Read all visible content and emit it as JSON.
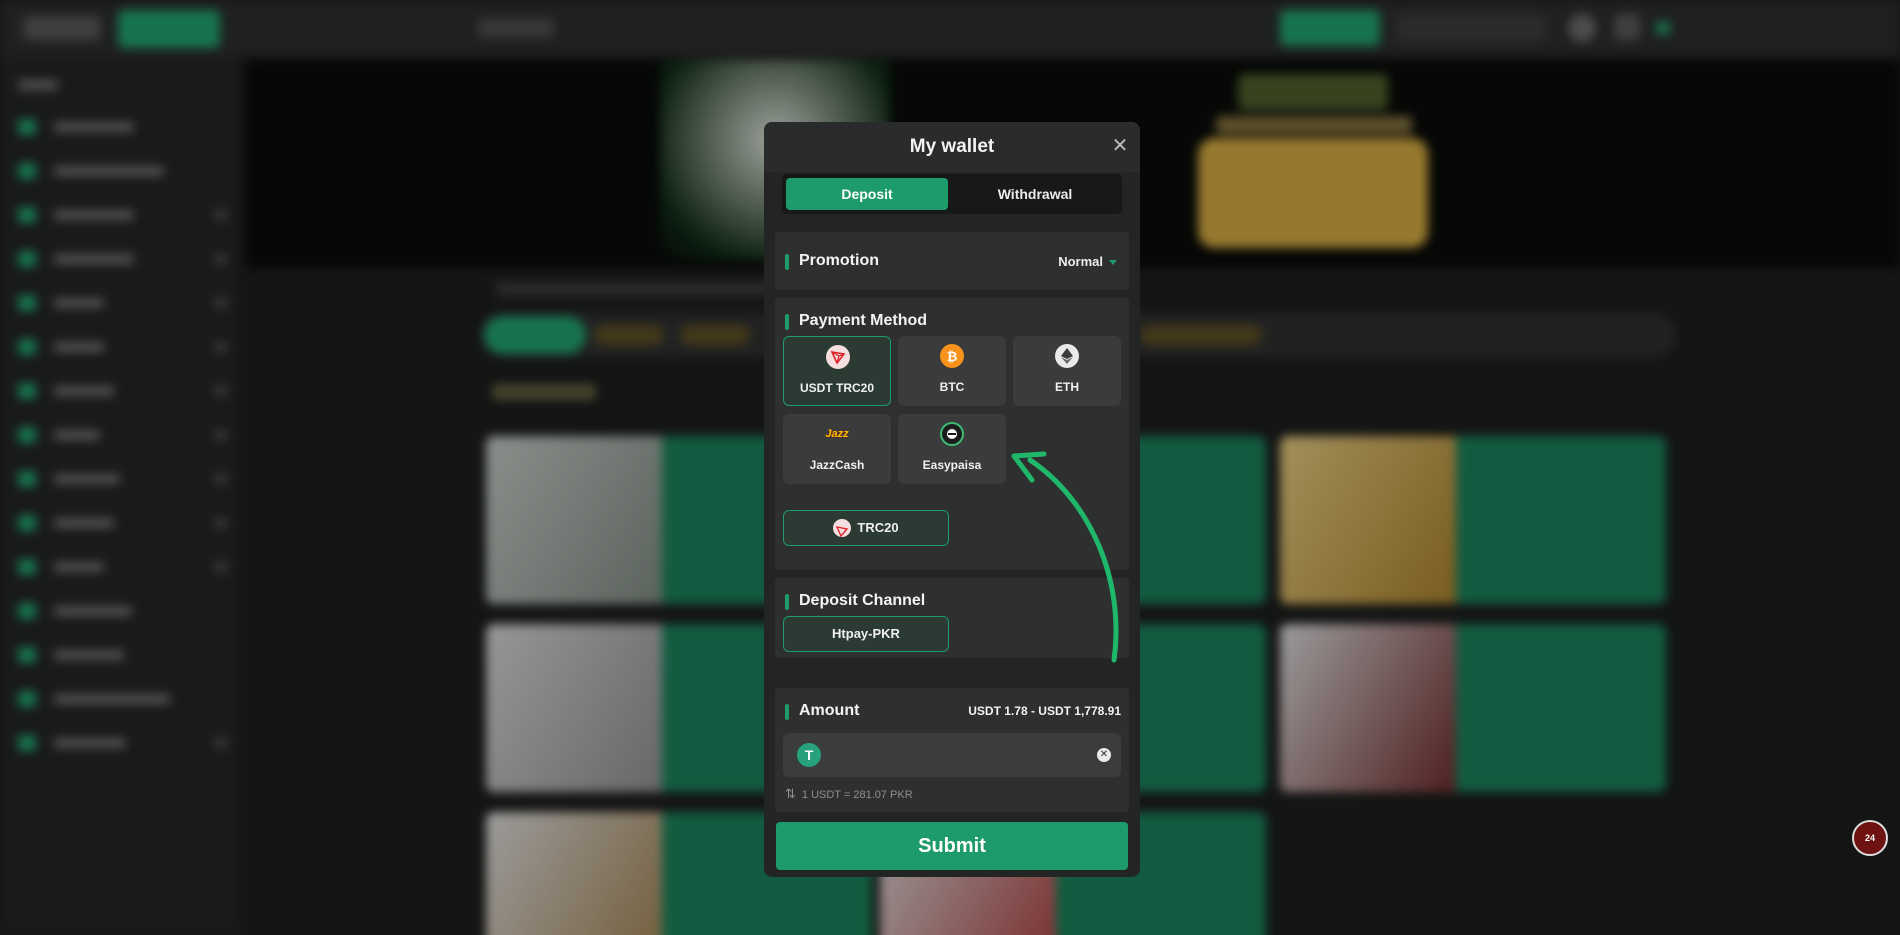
{
  "modal": {
    "title": "My wallet",
    "tabs": {
      "deposit": "Deposit",
      "withdrawal": "Withdrawal"
    }
  },
  "promotion": {
    "label": "Promotion",
    "value": "Normal"
  },
  "payment_method": {
    "label": "Payment Method",
    "options": [
      {
        "name": "USDT TRC20",
        "icon": "tron-icon",
        "selected": true
      },
      {
        "name": "BTC",
        "icon": "bitcoin-icon",
        "selected": false
      },
      {
        "name": "ETH",
        "icon": "ethereum-icon",
        "selected": false
      },
      {
        "name": "JazzCash",
        "icon": "jazzcash-icon",
        "selected": false
      },
      {
        "name": "Easypaisa",
        "icon": "easypaisa-icon",
        "selected": false
      }
    ],
    "network": "TRC20"
  },
  "deposit_channel": {
    "label": "Deposit Channel",
    "value": "Htpay-PKR"
  },
  "amount": {
    "label": "Amount",
    "range": "USDT 1.78 - USDT 1,778.91",
    "value": "",
    "rate": "1 USDT = 281.07 PKR"
  },
  "submit_label": "Submit",
  "support_badge": "24",
  "colors": {
    "accent": "#1d9b6b",
    "modal_bg": "#232424",
    "panel_bg": "#2e2f2f",
    "page_bg": "#1b1c1c"
  }
}
